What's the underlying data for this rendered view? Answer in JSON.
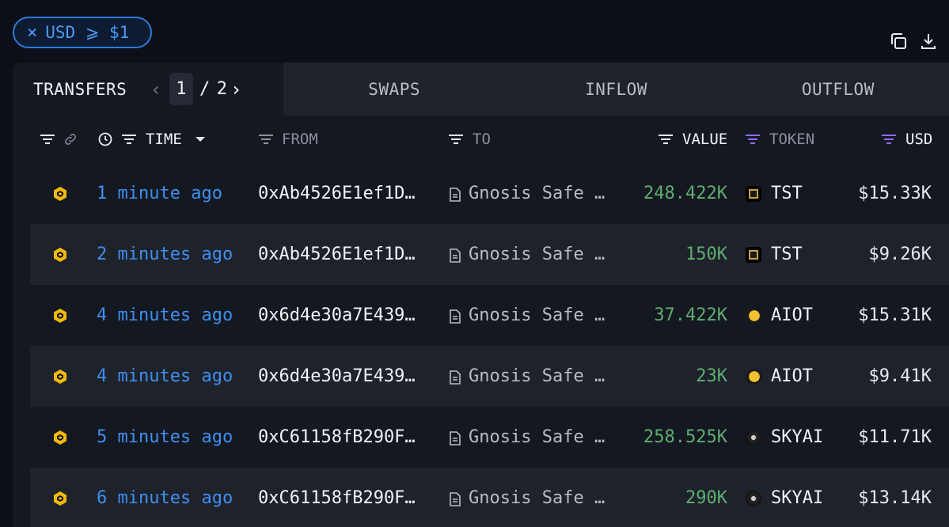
{
  "filter": {
    "close": "×",
    "label": "USD ⩾ $1"
  },
  "tabs": {
    "transfers": "TRANSFERS",
    "swaps": "SWAPS",
    "inflow": "INFLOW",
    "outflow": "OUTFLOW"
  },
  "pager": {
    "current": "1",
    "sep": "/",
    "total": "2"
  },
  "columns": {
    "time": "TIME",
    "from": "FROM",
    "to": "TO",
    "value": "VALUE",
    "token": "TOKEN",
    "usd": "USD"
  },
  "rows": [
    {
      "time": "1 minute ago",
      "from": "0xAb4526E1ef1D…",
      "to": "Gnosis Safe …",
      "value": "248.422K",
      "token": "TST",
      "usd": "$15.33K"
    },
    {
      "time": "2 minutes ago",
      "from": "0xAb4526E1ef1D…",
      "to": "Gnosis Safe …",
      "value": "150K",
      "token": "TST",
      "usd": "$9.26K"
    },
    {
      "time": "4 minutes ago",
      "from": "0x6d4e30a7E439…",
      "to": "Gnosis Safe …",
      "value": "37.422K",
      "token": "AIOT",
      "usd": "$15.31K"
    },
    {
      "time": "4 minutes ago",
      "from": "0x6d4e30a7E439…",
      "to": "Gnosis Safe …",
      "value": "23K",
      "token": "AIOT",
      "usd": "$9.41K"
    },
    {
      "time": "5 minutes ago",
      "from": "0xC61158fB290F…",
      "to": "Gnosis Safe …",
      "value": "258.525K",
      "token": "SKYAI",
      "usd": "$11.71K"
    },
    {
      "time": "6 minutes ago",
      "from": "0xC61158fB290F…",
      "to": "Gnosis Safe …",
      "value": "290K",
      "token": "SKYAI",
      "usd": "$13.14K"
    }
  ],
  "colors": {
    "accent": "#3f8ff0",
    "value_green": "#5fae72",
    "chain_yellow": "#f0b90b",
    "token_filter_purple": "#8e6cf0"
  }
}
